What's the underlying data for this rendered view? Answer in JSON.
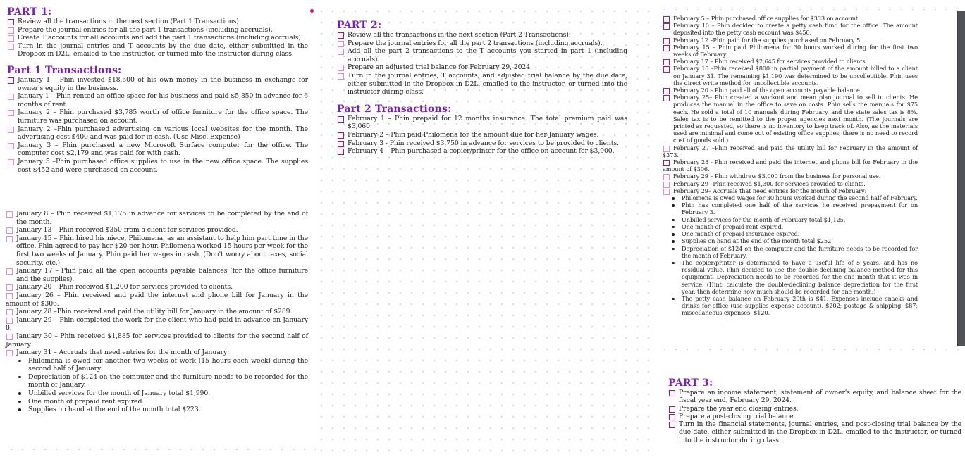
{
  "part1": {
    "heading": "PART 1:",
    "tasks": [
      "Review all the transactions in the next section (Part 1 Transactions).",
      "Prepare the journal entries for all the part 1 transactions (including accruals).",
      "Create T accounts for all accounts and add the part 1 transactions (including accruals).",
      "Turn in the journal entries and T accounts by the due date, either submitted in the Dropbox in D2L, emailed to the instructor, or turned into the instructor during class."
    ],
    "transactions_heading": "Part 1 Transactions:",
    "transactions_a": [
      "January 1 – Phin invested $18,500 of his own money in the business in exchange for owner's equity in the business.",
      "January 1 – Phin rented an office space for his business and paid $5,850 in advance for 6 months of rent.",
      "January 2 – Phin purchased $3,785 worth of office furniture for the office space. The furniture was purchased on account.",
      "January 2 –Phin purchased advertising on various local websites for the month. The advertising cost $400 and was paid for in cash. (Use Misc. Expense)",
      "January 3 – Phin purchased a new Microsoft Surface computer for the office. The computer cost $2,179 and was paid for with cash.",
      "January 5 –Phin purchased office supplies to use in the new office space. The supplies cost $452 and were purchased on account."
    ],
    "transactions_b": [
      "January 8 – Phin received $1,175 in advance for services to be completed by the end of the month.",
      "January 13 – Phin received $350 from a client for services provided.",
      "January 15 – Phin hired his niece, Philomena, as an assistant to help him part time in the office. Phin agreed to pay her $20 per hour. Philomena worked 15 hours per week for the first two weeks of January. Phin paid her wages in cash. (Don't worry about taxes, social security, etc.)",
      "January 17 – Phin paid all the open accounts payable balances (for the office furniture and the supplies).",
      "January 20 – Phin received $1,200 for services provided to clients."
    ],
    "transactions_c": [
      "January 26 – Phin received and paid the internet and phone bill for January in the amount of $306.",
      "January 28 –Phin received and paid the utility bill for January in the amount of $289.",
      "January 29 – Phin completed the work for the client who had paid in advance on January 8.",
      "January 30 – Phin received $1,885 for services provided to clients for the second half of January."
    ],
    "accruals_label": "January 31 – Accruals that need entries for the month of January:",
    "accruals": [
      "Philomena is owed for another two weeks of work (15 hours each week) during the second half of January.",
      "Depreciation of $124 on the computer and the furniture needs to be recorded for the month of January.",
      "Unbilled services for the month of January total $1,990.",
      "One month of prepaid rent expired.",
      "Supplies on hand at the end of the month total $223."
    ]
  },
  "part2": {
    "heading": "PART 2:",
    "tasks": [
      "Review all the transactions in the next section (Part 2 Transactions).",
      "Prepare the journal entries for all the part 2 transactions (including accruals).",
      "Add all the part 2 transactions to the T accounts you started in part 1 (including accruals).",
      "Prepare an adjusted trial balance for February 29, 2024.",
      "Turn in the journal entries, T accounts, and adjusted trial balance by the due date, either submitted in the Dropbox in D2L, emailed to the instructor, or turned into the instructor during class."
    ],
    "transactions_heading": "Part 2 Transactions:",
    "transactions_a": [
      "February 1 – Phin prepaid for 12 months insurance. The total premium paid was $3,060.",
      "February 2 – Phin paid Philomena for the amount due for her January wages.",
      "February 3 - Phin received $3,750 in advance for services to be provided to clients.",
      "February 4 – Phin purchased a copier/printer for the office on account for $3,900."
    ],
    "transactions_b": [
      "February 5 – Phin purchased office supplies for $333 on account.",
      "February 10 – Phin decided to create a petty cash fund for the office. The amount deposited into the petty cash account was $450.",
      "February 12 –Phin paid for the supplies purchased on February 5.",
      "February 15 – Phin paid Philomena for 30 hours worked during for the first two weeks of February.",
      "February 17 – Phin received $2,645 for services provided to clients.",
      "February 18 –Phin received $800 in partial payment of the amount billed to a client on January 31. The remaining $1,190 was determined to be uncollectible. Phin uses the direct write method for uncollectible accounts.",
      "February 20 – Phin paid all of the open accounts payable balance.",
      "February 25– Phin created a workout and mean plan journal to sell to clients. He produces the manual in the office to save on costs. Phin sells the manuals for $75 each. He sold a total of 10 manuals during February, and the state sales tax is 8%. Sales tax is to be remitted to the proper agencies next month. (The journals are printed as requested, so there is no inventory to keep track of. Also, as the materials used are minimal and come out of existing office supplies, there is no need to record cost of goods sold.)"
    ],
    "transactions_c": [
      "February 27 –Phin received and paid the utility bill for February in the amount of $373.",
      "February 28 - Phin received and paid the internet and phone bill for February in the amount of $306."
    ],
    "transactions_d": [
      "February 29 – Phin withdrew $3,000 from the business for personal use.",
      "February 29 –Phin received $1,300 for services provided to clients."
    ],
    "accruals_label": "February 29– Accruals that need entries for the month of February:",
    "accruals": [
      "Philomena is owed wages for 30 hours worked during the second half of February.",
      "Phin has completed one half of the services he received prepayment for on February 3.",
      "Unbilled services for the month of February total $1,125.",
      "One month of prepaid rent expired.",
      "One month of prepaid insurance expired.",
      "Supplies on hand at the end of the month total $252.",
      "Depreciation of $124 on the computer and the furniture needs to be recorded for the month of February.",
      "The copier/printer is determined to have a useful life of 5 years, and has no residual value. Phin decided to use the double-declining balance method for this equipment. Depreciation needs to be recorded for the one month that it was in service. (Hint: calculate the double-declining balance depreciation for the first year, then determine how much should be recorded for one month.)",
      "The petty cash balance on February 29th is $41. Expenses include snacks and drinks for office (use supplies expense account), $202; postage & shipping, $87; miscellaneous expenses, $120."
    ]
  },
  "part3": {
    "heading": "PART 3:",
    "tasks": [
      "Prepare an income statement, statement of  owner's equity, and balance sheet for the fiscal year end, February 29, 2024.",
      "Prepare the year end closing entries.",
      "Prepare a post-closing trial balance.",
      "Turn in the financial statements, journal entries, and post-closing trial balance by the due date, either submitted in the Dropbox in D2L, emailed to the instructor, or turned into the instructor during class."
    ]
  },
  "colors": {
    "heading": "#7a1fb8",
    "checkbox_light": "#e38ac9",
    "checkbox_dark": "#b3117e",
    "marker_dot": "#cc0a8f"
  }
}
